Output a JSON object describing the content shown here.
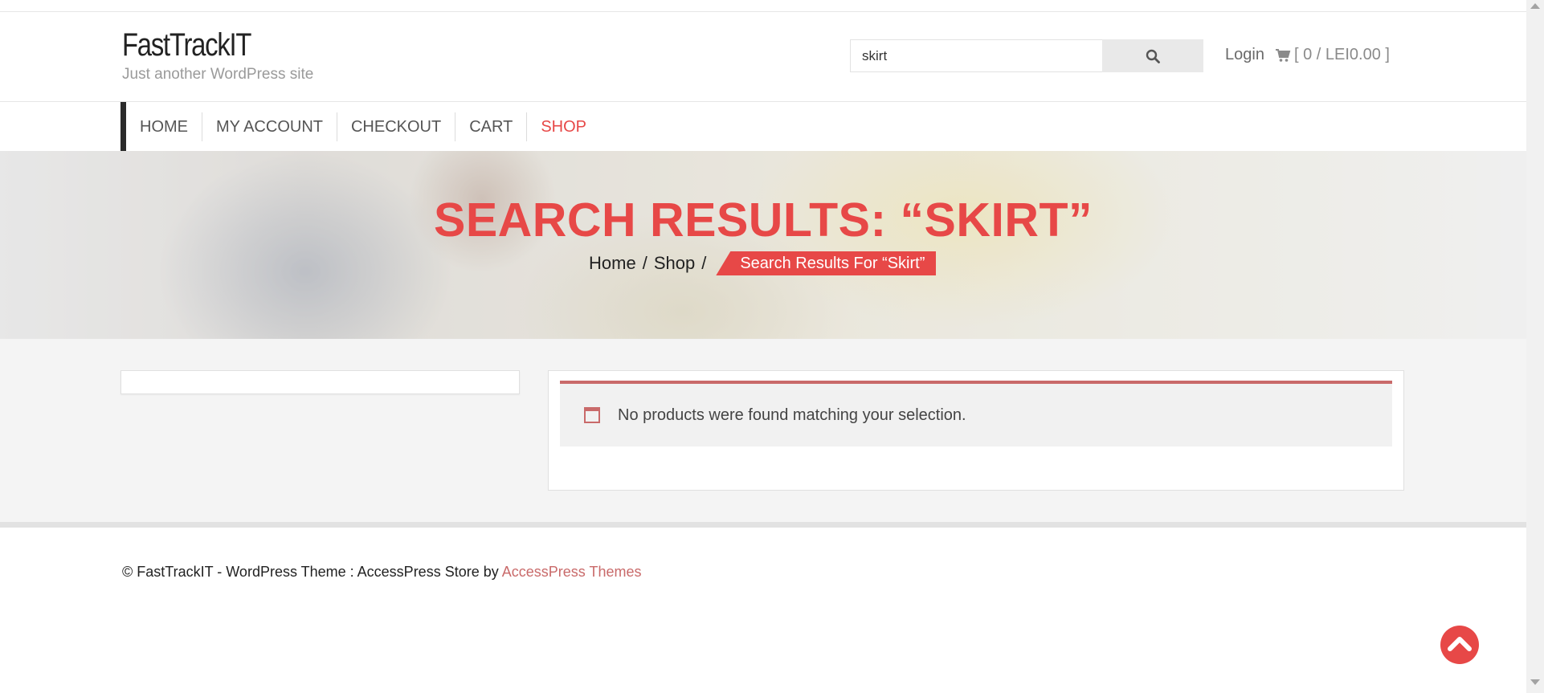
{
  "site": {
    "title": "FastTrackIT",
    "description": "Just another WordPress site"
  },
  "header": {
    "search_value": "skirt",
    "search_icon": "search-icon",
    "login_label": "Login",
    "cart_icon": "cart-icon",
    "cart_summary": "[ 0 / LEI0.00 ]"
  },
  "nav": {
    "items": [
      {
        "label": "HOME"
      },
      {
        "label": "MY ACCOUNT"
      },
      {
        "label": "CHECKOUT"
      },
      {
        "label": "CART"
      },
      {
        "label": "SHOP"
      }
    ],
    "active_index": 4
  },
  "banner": {
    "title": "SEARCH RESULTS: “SKIRT”",
    "breadcrumb": {
      "home": "Home",
      "shop": "Shop",
      "separator": "/",
      "current": "Search Results For “Skirt”"
    }
  },
  "main": {
    "notice_icon": "info-icon",
    "notice_text": "No products were found matching your selection."
  },
  "footer": {
    "text": "© FastTrackIT - WordPress Theme : AccessPress Store by",
    "link_label": "AccessPress Themes"
  },
  "colors": {
    "accent": "#e74847",
    "notice_border": "#c96a6a"
  },
  "back_to_top_icon": "chevron-up-circle-icon"
}
